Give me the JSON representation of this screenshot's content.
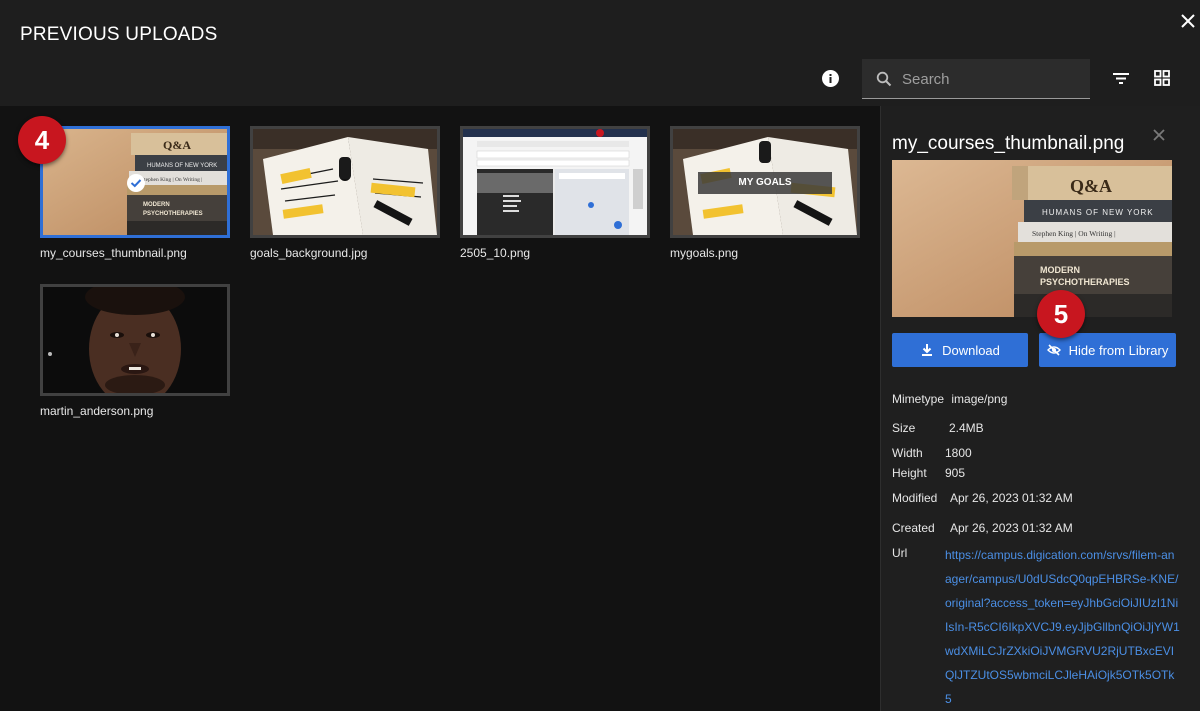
{
  "header": {
    "title": "PREVIOUS UPLOADS",
    "search_placeholder": "Search"
  },
  "gallery": {
    "items": [
      {
        "name": "my_courses_thumbnail.png",
        "selected": true
      },
      {
        "name": "goals_background.jpg",
        "selected": false
      },
      {
        "name": "2505_10.png",
        "selected": false
      },
      {
        "name": "mygoals.png",
        "selected": false,
        "overlay_text": "MY GOALS"
      },
      {
        "name": "martin_anderson.png",
        "selected": false
      }
    ]
  },
  "badges": {
    "step4": "4",
    "step5": "5"
  },
  "detail": {
    "title": "my_courses_thumbnail.png",
    "download_label": "Download",
    "hide_label": "Hide from Library",
    "mimetype_label": "Mimetype",
    "mimetype_value": "image/png",
    "size_label": "Size",
    "size_value": "2.4MB",
    "width_label": "Width",
    "width_value": "1800",
    "height_label": "Height",
    "height_value": "905",
    "modified_label": "Modified",
    "modified_value": "Apr 26, 2023 01:32 AM",
    "created_label": "Created",
    "created_value": "Apr 26, 2023 01:32 AM",
    "url_label": "Url",
    "url_value": "https://campus.digication.com/srvs/filem-anager/campus/U0dUSdcQ0qpEHBRSe-KNE/original?access_token=eyJhbGciOiJIUzI1NiIsIn-R5cCI6IkpXVCJ9.eyJjbGllbnQiOiJjYW1wdXMiLCJrZXkiOiJVMGRVU2RjUTBxcEVIQlJTZUtOS5wbmciLCJleHAiOjk5OTk5OTk5"
  },
  "books": {
    "qa": "Q&A",
    "humans": "HUMANS OF NEW YORK",
    "onwriting": "Stephen King | On Writing |",
    "modern1": "MODERN",
    "modern2": "PSYCHOTHERAPIES"
  },
  "icons": {
    "close": "close-icon",
    "info": "info-icon",
    "search": "search-icon",
    "filter": "filter-icon",
    "grid": "grid-view-icon",
    "download": "download-icon",
    "hide": "eye-off-icon",
    "check": "check-icon"
  },
  "colors": {
    "accent": "#2f6fd6",
    "badge": "#c8161f",
    "link": "#4b8fe5",
    "panel": "#1f1f1f",
    "background": "#121212"
  }
}
